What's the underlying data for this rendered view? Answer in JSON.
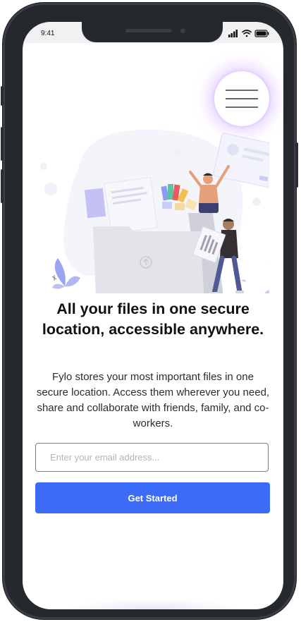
{
  "status_bar": {
    "time": "9:41"
  },
  "hero": {
    "headline": "All your files in one secure location, accessible anywhere.",
    "description": "Fylo stores your most important files in one secure location. Access them wherever you need, share and collaborate with friends, family, and co-workers."
  },
  "signup": {
    "email_placeholder": "Enter your email address...",
    "email_value": "",
    "button_label": "Get Started"
  },
  "icons": {
    "menu": "hamburger-icon",
    "signal": "signal-bars-icon",
    "wifi": "wifi-icon",
    "battery": "battery-icon",
    "upload": "upload-icon"
  },
  "colors": {
    "accent": "#3b6bf7",
    "frame": "#25282d",
    "menu_glow": "#c396ff"
  }
}
